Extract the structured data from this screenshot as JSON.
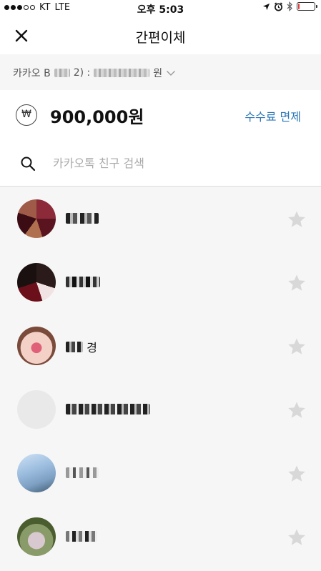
{
  "status_bar": {
    "carrier": "KT",
    "network": "LTE",
    "time": "오후 5:03"
  },
  "nav": {
    "title": "간편이체"
  },
  "account": {
    "label_prefix": "카카오 B",
    "label_mid": "2) :",
    "label_suffix": "원"
  },
  "amount": {
    "currency_symbol": "₩",
    "value": "900,000원",
    "fee_label": "수수료 면제"
  },
  "search": {
    "placeholder": "카카오톡 친구 검색"
  },
  "friends": [
    {
      "name_suffix": ""
    },
    {
      "name_suffix": ""
    },
    {
      "name_suffix": "경"
    },
    {
      "name_suffix": ""
    },
    {
      "name_suffix": ""
    },
    {
      "name_suffix": ""
    }
  ],
  "colors": {
    "accent_link": "#2a76b8",
    "battery_low": "#e53b3b",
    "star_inactive": "#d8d8d8"
  },
  "battery_level": 0.12
}
